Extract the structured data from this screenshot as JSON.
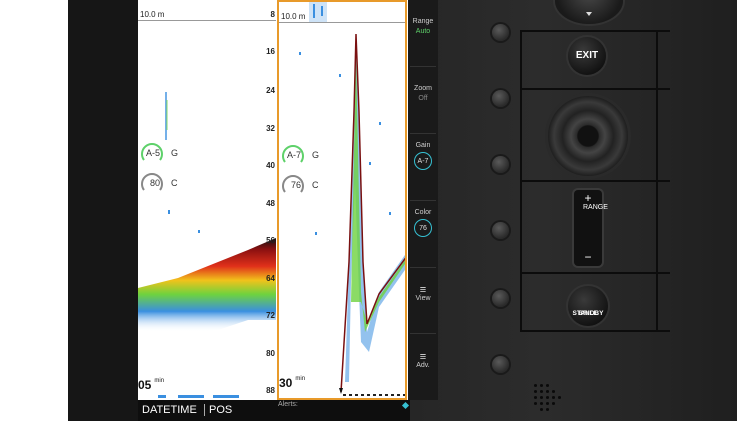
{
  "screen": {
    "left_pane": {
      "range_label": "10.0 m",
      "time_label": "05",
      "time_unit": "min",
      "gain_gauge": {
        "value": "A-5",
        "tag": "G"
      },
      "color_gauge": {
        "value": "80",
        "tag": "C"
      }
    },
    "right_pane": {
      "range_label": "10.0 m",
      "time_label": "30",
      "time_unit": "min",
      "gain_gauge": {
        "value": "A-7",
        "tag": "G"
      },
      "color_gauge": {
        "value": "76",
        "tag": "C"
      }
    },
    "depth_ticks": [
      "8",
      "16",
      "24",
      "32",
      "40",
      "48",
      "56",
      "64",
      "72",
      "80",
      "88"
    ],
    "side_menu": {
      "range": {
        "label": "Range",
        "value": "Auto"
      },
      "zoom": {
        "label": "Zoom",
        "value": "Off"
      },
      "gain": {
        "label": "Gain",
        "value": "A-7"
      },
      "color": {
        "label": "Color",
        "value": "76"
      },
      "view": {
        "label": "View",
        "glyph": "≡"
      },
      "adv": {
        "label": "Adv.",
        "glyph": "≡"
      }
    },
    "bottom_bar": {
      "datetime": "DATETIME",
      "pos": "POS",
      "alerts": "Alerts:"
    }
  },
  "hardware": {
    "exit_label": "EXIT",
    "range_rocker": {
      "plus": "+",
      "minus": "−",
      "label": "RANGE"
    },
    "standby_label_line1": "STANDBY",
    "standby_label_line2": "BRILL"
  },
  "colors": {
    "accent_orange": "#e89a2a",
    "accent_cyan": "#36c0d2",
    "accent_green": "#5ed16a",
    "bezel": "#1a1a1a"
  }
}
